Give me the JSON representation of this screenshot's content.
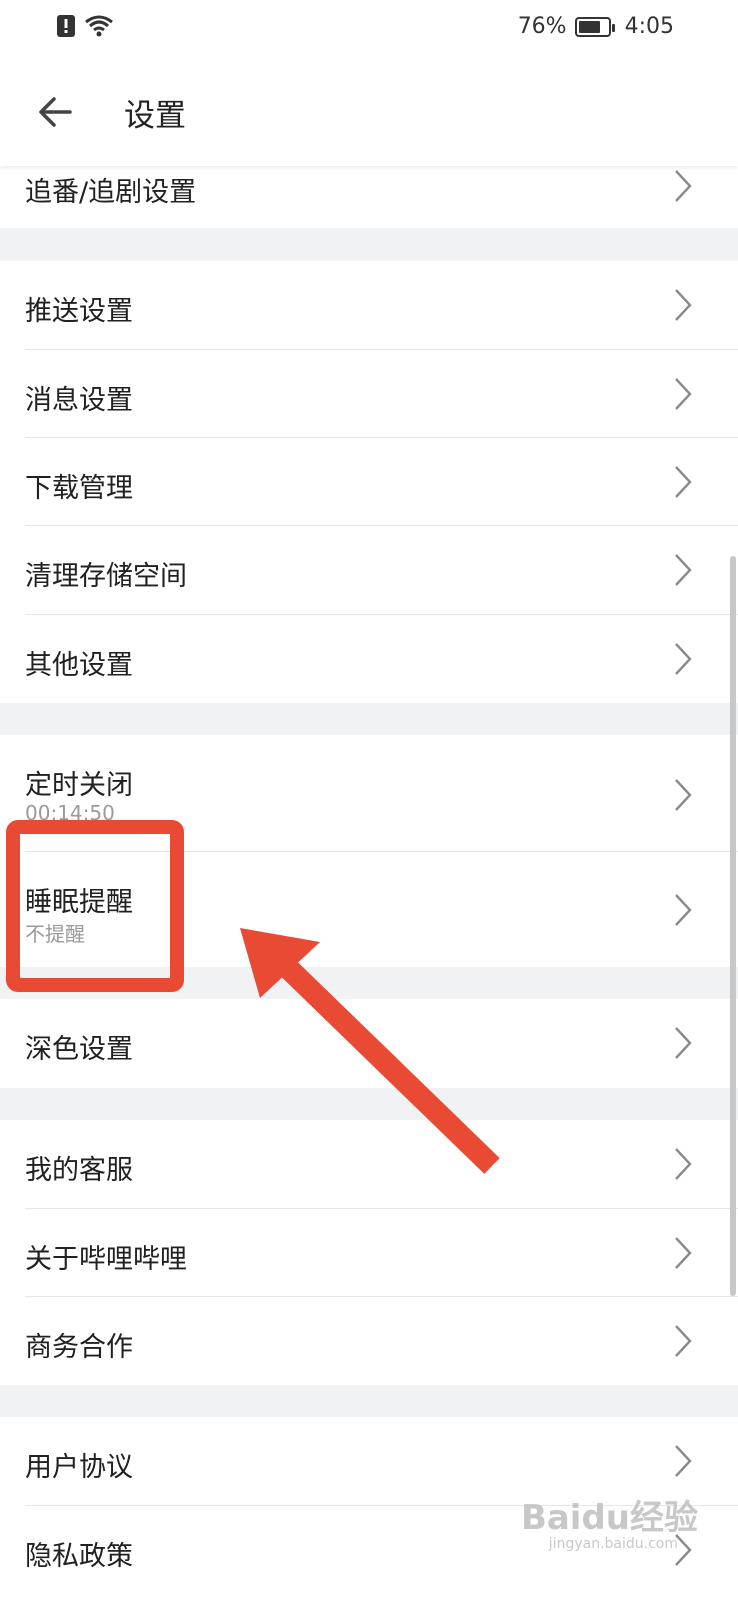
{
  "status_bar": {
    "battery_percent": "76%",
    "battery_level": 0.76,
    "time": "4:05",
    "icons": [
      "alert-icon",
      "wifi-icon"
    ]
  },
  "app_bar": {
    "title": "设置"
  },
  "settings": {
    "anime_drama": "追番/追剧设置",
    "push": "推送设置",
    "messages": "消息设置",
    "download": "下载管理",
    "storage": "清理存储空间",
    "other": "其他设置",
    "timer_close": "定时关闭",
    "timer_close_value": "00:14:50",
    "sleep_reminder": "睡眠提醒",
    "sleep_reminder_value": "不提醒",
    "dark_mode": "深色设置",
    "customer_service": "我的客服",
    "about": "关于哔哩哔哩",
    "business": "商务合作",
    "user_agreement": "用户协议",
    "privacy": "隐私政策"
  },
  "watermark": {
    "brand": "Baidu经验",
    "url": "jingyan.baidu.com"
  },
  "colors": {
    "annotation": "#e84a33",
    "background": "#f1f2f4",
    "row": "#ffffff"
  }
}
